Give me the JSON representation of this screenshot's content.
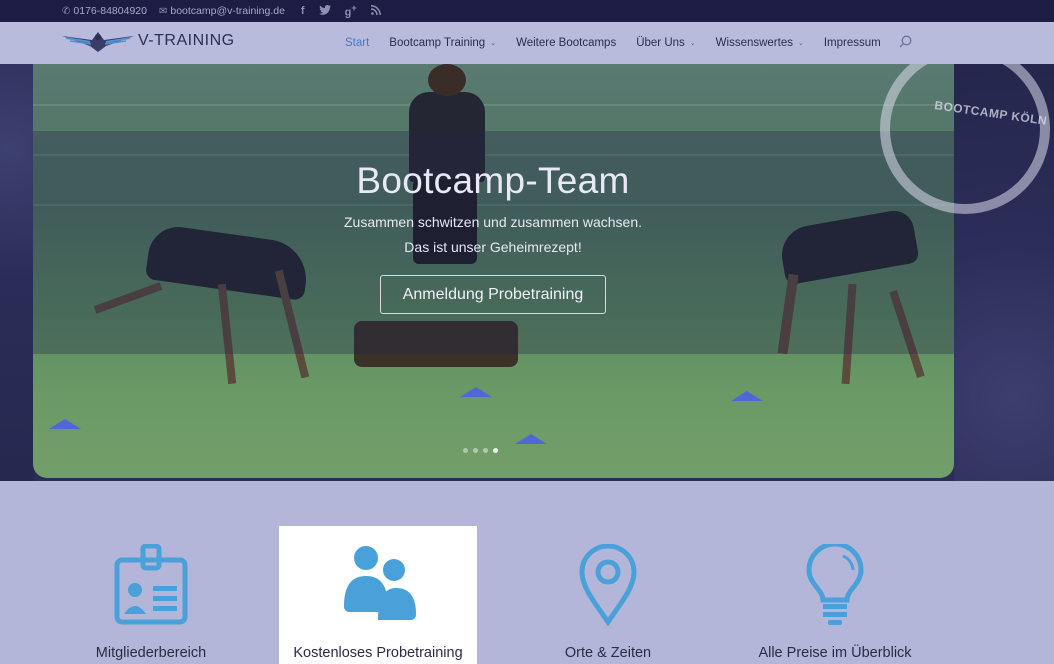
{
  "topbar": {
    "phone": "0176-84804920",
    "email": "bootcamp@v-training.de",
    "social": [
      "facebook-icon",
      "twitter-icon",
      "google-plus-icon",
      "rss-icon"
    ]
  },
  "header": {
    "brand": "V-TRAINING",
    "nav": [
      {
        "label": "Start",
        "active": true,
        "dropdown": false
      },
      {
        "label": "Bootcamp Training",
        "active": false,
        "dropdown": true
      },
      {
        "label": "Weitere Bootcamps",
        "active": false,
        "dropdown": false
      },
      {
        "label": "Über Uns",
        "active": false,
        "dropdown": true
      },
      {
        "label": "Wissenswertes",
        "active": false,
        "dropdown": true
      },
      {
        "label": "Impressum",
        "active": false,
        "dropdown": false
      }
    ]
  },
  "hero": {
    "title": "Bootcamp-Team",
    "subtitle_line1": "Zusammen schwitzen und zusammen wachsen.",
    "subtitle_line2": "Das ist unser Geheimrezept!",
    "button": "Anmeldung Probetraining",
    "stamp_text": "BOOTCAMP KÖLN"
  },
  "features": [
    {
      "label": "Mitgliederbereich",
      "icon": "id-badge-icon"
    },
    {
      "label": "Kostenloses Probetraining",
      "icon": "group-icon"
    },
    {
      "label": "Orte & Zeiten",
      "icon": "map-pin-icon"
    },
    {
      "label": "Alle Preise im Überblick",
      "icon": "lightbulb-icon"
    }
  ],
  "colors": {
    "topbar_bg": "#1c1c45",
    "header_bg": "#b9bbdc",
    "accent": "#4a78c2",
    "icon_blue": "#4aa0d8",
    "feature_bg": "#b3b6d9"
  }
}
